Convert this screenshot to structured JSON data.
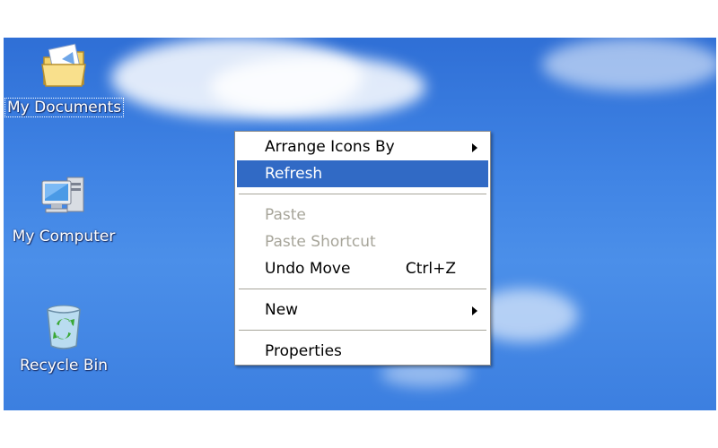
{
  "desktop": {
    "icons": [
      {
        "label": "My Documents",
        "icon": "folder-documents-icon"
      },
      {
        "label": "My Computer",
        "icon": "computer-icon"
      },
      {
        "label": "Recycle Bin",
        "icon": "recycle-bin-icon"
      }
    ]
  },
  "context_menu": {
    "items": [
      {
        "label": "Arrange Icons By",
        "submenu": true,
        "enabled": true
      },
      {
        "label": "Refresh",
        "highlighted": true,
        "enabled": true
      },
      {
        "label": "Paste",
        "enabled": false
      },
      {
        "label": "Paste Shortcut",
        "enabled": false
      },
      {
        "label": "Undo Move",
        "shortcut": "Ctrl+Z",
        "enabled": true
      },
      {
        "label": "New",
        "submenu": true,
        "enabled": true
      },
      {
        "label": "Properties",
        "enabled": true
      }
    ]
  },
  "colors": {
    "menu_highlight": "#316ac5",
    "disabled_text": "#a7a59a",
    "desktop_sky": "#3f83e4"
  }
}
